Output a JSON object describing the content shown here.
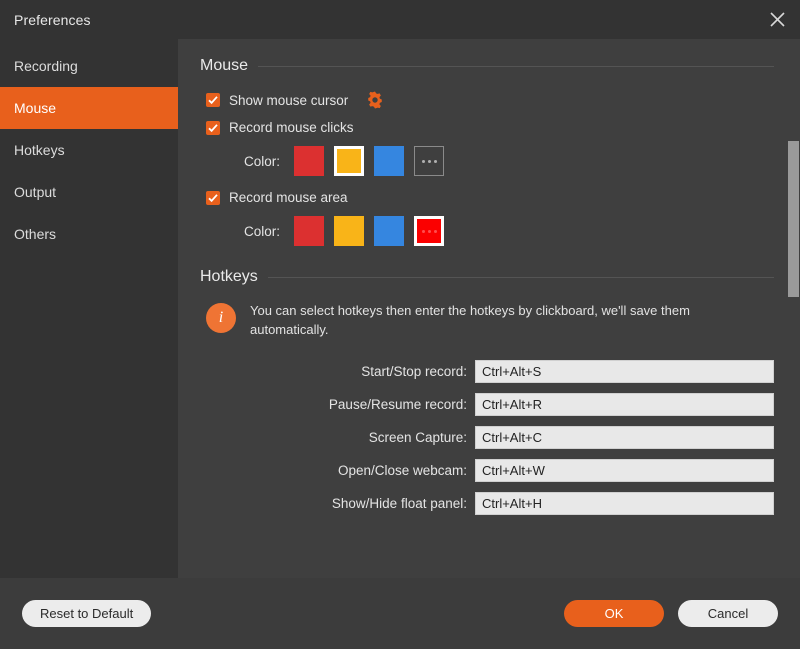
{
  "window": {
    "title": "Preferences",
    "close_icon": "close-icon"
  },
  "sidebar": {
    "items": [
      {
        "label": "Recording",
        "active": false
      },
      {
        "label": "Mouse",
        "active": true
      },
      {
        "label": "Hotkeys",
        "active": false
      },
      {
        "label": "Output",
        "active": false
      },
      {
        "label": "Others",
        "active": false
      }
    ]
  },
  "mouse_section": {
    "title": "Mouse",
    "show_cursor": {
      "label": "Show mouse cursor",
      "checked": true,
      "settings_icon": "gear-icon"
    },
    "record_clicks": {
      "label": "Record mouse clicks",
      "checked": true,
      "color_label": "Color:",
      "swatches": [
        {
          "name": "red",
          "color": "#dc3030",
          "selected": false
        },
        {
          "name": "yellow",
          "color": "#f9b418",
          "selected": true
        },
        {
          "name": "blue",
          "color": "#3586e0",
          "selected": false
        },
        {
          "name": "more",
          "color": "",
          "selected": false
        }
      ]
    },
    "record_area": {
      "label": "Record mouse area",
      "checked": true,
      "color_label": "Color:",
      "swatches": [
        {
          "name": "red",
          "color": "#dc3030",
          "selected": false
        },
        {
          "name": "yellow",
          "color": "#f9b418",
          "selected": false
        },
        {
          "name": "blue",
          "color": "#3586e0",
          "selected": false
        },
        {
          "name": "more",
          "color": "#fb0000",
          "selected": true
        }
      ]
    }
  },
  "hotkeys_section": {
    "title": "Hotkeys",
    "info_icon": "info-icon",
    "info_text": "You can select hotkeys then enter the hotkeys by clickboard, we'll save them automatically.",
    "rows": [
      {
        "label": "Start/Stop record:",
        "value": "Ctrl+Alt+S"
      },
      {
        "label": "Pause/Resume record:",
        "value": "Ctrl+Alt+R"
      },
      {
        "label": "Screen Capture:",
        "value": "Ctrl+Alt+C"
      },
      {
        "label": "Open/Close webcam:",
        "value": "Ctrl+Alt+W"
      },
      {
        "label": "Show/Hide float panel:",
        "value": "Ctrl+Alt+H"
      }
    ]
  },
  "footer": {
    "reset_label": "Reset to Default",
    "ok_label": "OK",
    "cancel_label": "Cancel"
  },
  "colors": {
    "accent": "#e8601c",
    "sidebar_bg": "#333333",
    "content_bg": "#3f3f3f",
    "window_bg": "#3c3c3c"
  }
}
